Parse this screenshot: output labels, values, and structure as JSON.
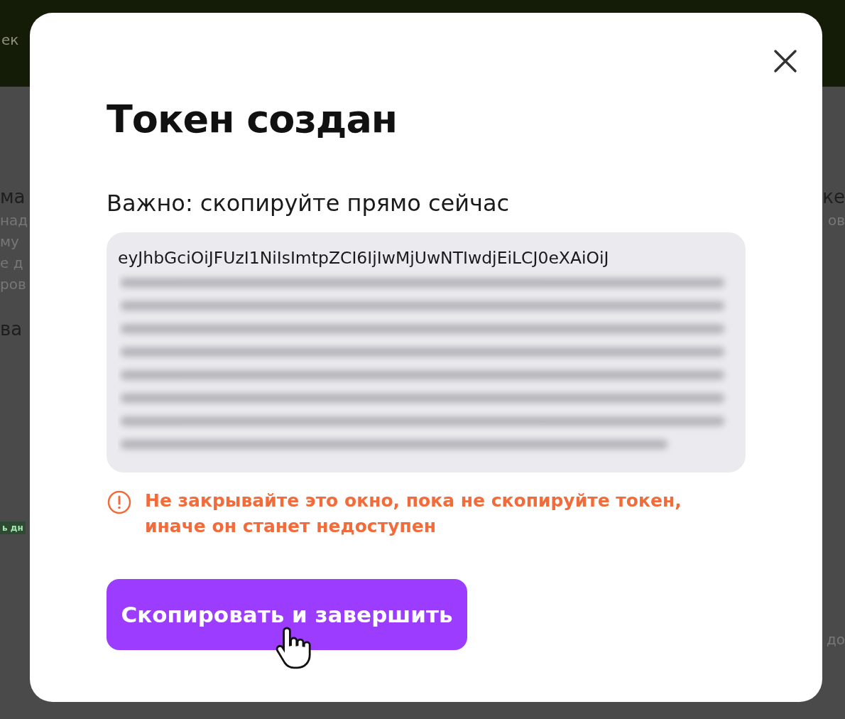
{
  "background": {
    "header_fragment": "ек",
    "left_fragments": [
      {
        "kind": "heading",
        "text": "ма"
      },
      {
        "kind": "body",
        "text": "над"
      },
      {
        "kind": "body",
        "text": "му"
      },
      {
        "kind": "body",
        "text": "е д"
      },
      {
        "kind": "body",
        "text": "ров"
      },
      {
        "kind": "heading",
        "text": "ва"
      },
      {
        "kind": "tag",
        "text": "ь дн"
      }
    ],
    "right_fragments": [
      {
        "kind": "heading",
        "text": "ке"
      },
      {
        "kind": "body",
        "text": "ов"
      },
      {
        "kind": "body",
        "text": "до"
      }
    ]
  },
  "dialog": {
    "title": "Токен создан",
    "subtitle": "Важно: скопируйте прямо сейчас",
    "token_visible": "eyJhbGciOiJFUzI1NiIsImtpZCI6IjIwMjUwNTIwdjEiLCJ0eXAiOiJ",
    "warning": "Не закрывайте это окно, пока не скопируйте токен, иначе он станет недоступен",
    "button": "Скопировать и завершить"
  }
}
